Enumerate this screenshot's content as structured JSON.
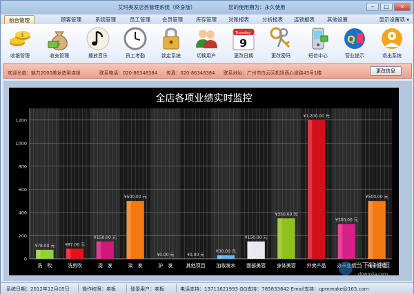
{
  "app_title": "艾玛美发店务管理系统（终身版）",
  "expiry_text": "您的使用期为：永久使用",
  "menu": [
    "前台管理",
    "顾客管理",
    "系统管理",
    "员工管理",
    "会员管理",
    "库存管理",
    "对账报表",
    "分析报表",
    "连锁报表",
    "其他设置"
  ],
  "display_settings": "显示设置项 ▾",
  "toolbar": [
    {
      "label": "收银管理",
      "icon": "coins-icon"
    },
    {
      "label": "收支管理",
      "icon": "money-bag-icon"
    },
    {
      "label": "播放音乐",
      "icon": "music-icon"
    },
    {
      "label": "员工考勤",
      "icon": "clock-icon"
    },
    {
      "label": "锁定系统",
      "icon": "lock-icon"
    },
    {
      "label": "切换用户",
      "icon": "users-icon"
    },
    {
      "label": "更改日期",
      "icon": "calendar-icon"
    },
    {
      "label": "更改密码",
      "icon": "keys-icon"
    },
    {
      "label": "短信中心",
      "icon": "phone-icon"
    },
    {
      "label": "营业提示",
      "icon": "tip-icon"
    },
    {
      "label": "退出系统",
      "icon": "exit-icon"
    }
  ],
  "calendar_icon": {
    "weekday": "Tuesday",
    "day": "9"
  },
  "info": {
    "welcome": "欢迎光临：魅力2000美发造型连锁",
    "phone": "联系电话：020-86348384",
    "fax": "传真：020-86348384",
    "address": "联系地址：广州市白云区机场西心道路45号1楼",
    "button": "更改信息"
  },
  "chart_data": {
    "type": "bar",
    "title": "全店各项业绩实时监控",
    "categories": [
      "洗　吹",
      "洗剪吹",
      "烫　发",
      "染　发",
      "护　发",
      "其他项目",
      "加收发水",
      "面部美容",
      "身体美容",
      "外卖产品",
      "办卡业绩",
      "充卡业绩"
    ],
    "values": [
      78,
      87,
      150,
      500,
      0,
      0,
      30,
      150,
      350,
      1200,
      300,
      500
    ],
    "data_labels": [
      "¥78.00 元",
      "¥87.00 元",
      "¥150.00 元",
      "¥500.00 元",
      "¥0.00 元",
      "¥0.00 元",
      "¥30.00 元",
      "¥150.00 元",
      "¥350.00 元",
      "¥1,200.00 元",
      "¥300.00 元",
      "¥500.00 元"
    ],
    "colors": [
      "#8fd13a",
      "#e8101a",
      "#d0187a",
      "#f27a13",
      "#888888",
      "#888888",
      "#5fb8f0",
      "#e8e8ee",
      "#8fc11f",
      "#d0101a",
      "#d8208a",
      "#f27a13"
    ],
    "y_ticks": [
      0,
      200,
      400,
      600,
      800,
      1000,
      1200
    ],
    "ylim": [
      0,
      1300
    ]
  },
  "status": {
    "date": "系统日期：2012年12月05日",
    "role": "操作权限：老板",
    "login": "登录用户：老板",
    "support": "电话支持：13711621993  QQ支持：785833842  Email支持：qpmmake@163.com"
  },
  "watermark": {
    "top": "当下软件园",
    "bottom": "downxia.com"
  }
}
